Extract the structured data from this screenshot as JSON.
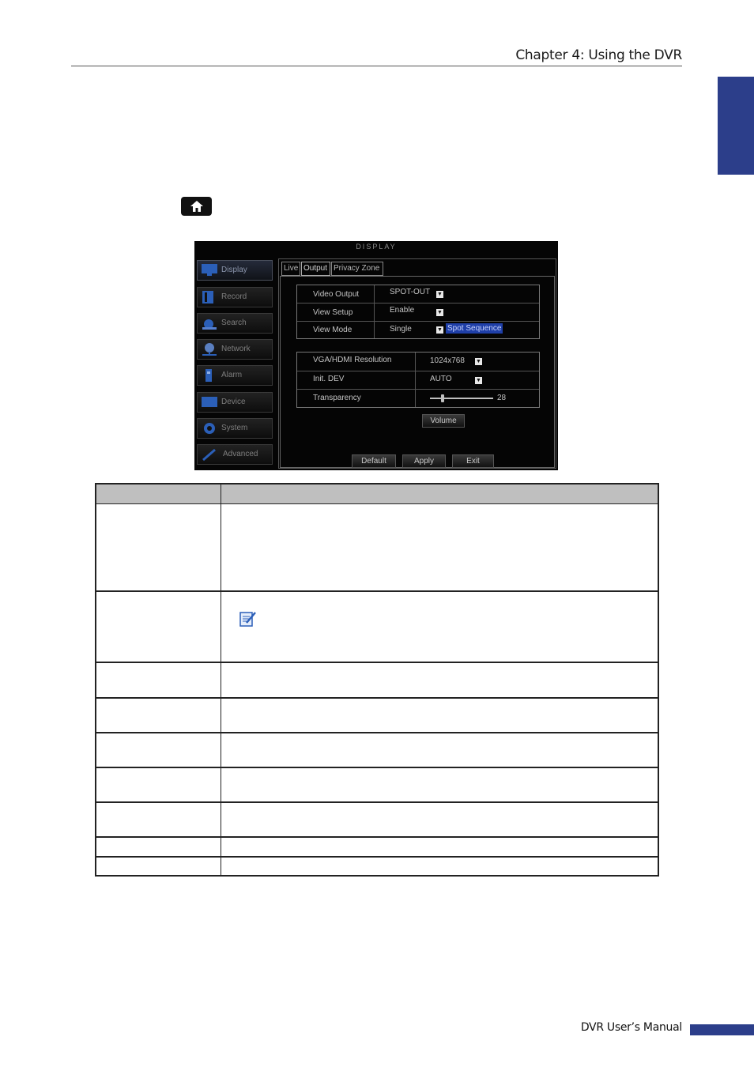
{
  "header": {
    "chapter": "Chapter 4: Using the DVR"
  },
  "accent_color": "#2c3e8a",
  "icons": {
    "home": "home-icon",
    "note": "note-icon"
  },
  "dvr": {
    "title": "DISPLAY",
    "menu": [
      {
        "label": "Display",
        "icon": "monitor-icon",
        "active": true
      },
      {
        "label": "Record",
        "icon": "film-icon",
        "active": false
      },
      {
        "label": "Search",
        "icon": "magnifier-icon",
        "active": false
      },
      {
        "label": "Network",
        "icon": "globe-icon",
        "active": false
      },
      {
        "label": "Alarm",
        "icon": "alarm-icon",
        "active": false
      },
      {
        "label": "Device",
        "icon": "device-icon",
        "active": false
      },
      {
        "label": "System",
        "icon": "gear-icon",
        "active": false
      },
      {
        "label": "Advanced",
        "icon": "wrench-icon",
        "active": false
      }
    ],
    "tabs": [
      {
        "label": "Live",
        "active": false
      },
      {
        "label": "Output",
        "active": true
      },
      {
        "label": "Privacy Zone",
        "active": false
      }
    ],
    "output": {
      "video_output_label": "Video Output",
      "video_output_value": "SPOT-OUT",
      "view_setup_label": "View Setup",
      "view_setup_value": "Enable",
      "view_mode_label": "View Mode",
      "view_mode_value": "Single",
      "spot_sequence_label": "Spot Sequence"
    },
    "display": {
      "resolution_label": "VGA/HDMI Resolution",
      "resolution_value": "1024x768",
      "init_dev_label": "Init. DEV",
      "init_dev_value": "AUTO",
      "transparency_label": "Transparency",
      "transparency_value": "28"
    },
    "buttons": {
      "volume": "Volume",
      "default": "Default",
      "apply": "Apply",
      "exit": "Exit"
    }
  },
  "footer": {
    "text": "DVR User’s Manual"
  }
}
